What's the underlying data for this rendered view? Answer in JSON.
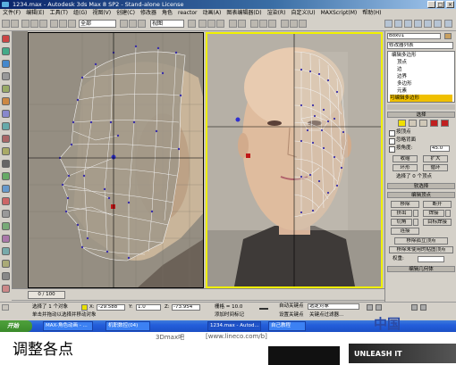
{
  "window": {
    "title": "1234.max - Autodesk 3ds Max 8 SP2 - Stand-alone License",
    "controls": [
      "_",
      "□",
      "×"
    ]
  },
  "menu": [
    "文件(F)",
    "编辑(E)",
    "工具(T)",
    "组(G)",
    "视图(V)",
    "创建(C)",
    "修改器",
    "角色",
    "reactor",
    "动画(A)",
    "图表编辑器(D)",
    "渲染(R)",
    "自定义(U)",
    "MAXScript(M)",
    "帮助(H)"
  ],
  "toolbar": {
    "filter_select": "全部",
    "view_select": "视图"
  },
  "command_panel": {
    "object_name": "Box01",
    "modifier_list": "修改器列表",
    "stack": [
      "编辑多边形",
      "顶点",
      "边",
      "边界",
      "多边形",
      "元素",
      "可编辑多边形"
    ],
    "selection_header": "选择",
    "by_vertex": "按顶点",
    "ignore_backface": "忽略背面",
    "by_angle": "按角度:",
    "angle_value": "45.0",
    "shrink": "收缩",
    "grow": "扩大",
    "ring": "环形",
    "loop": "循环",
    "selected_count": "选择了 0 个顶点",
    "soft_selection": "软选择",
    "edit_vertices": "编辑顶点",
    "remove": "移除",
    "break": "断开",
    "extrude": "挤出",
    "weld": "焊接",
    "chamfer": "切角",
    "target_weld": "目标焊接",
    "connect": "连接",
    "remove_isolated": "移除孤立顶点",
    "remove_unused_map": "移除未使用的贴图顶点",
    "weight_label": "权重:",
    "edit_geometry": "编辑几何体"
  },
  "timeline": {
    "frame": "0 / 100"
  },
  "status": {
    "selection": "选择了 1 个对象",
    "x": "-29.588",
    "y": "1.0",
    "z": "-73.954",
    "grid": "栅格 = 10.0",
    "autokey": "自动关键点",
    "set_key": "设置关键点",
    "selected_filter": "选定对象",
    "key_filters": "关键点过滤器...",
    "hint": "单击并拖动以选择并移动对象",
    "add_time_tag": "添加时间标记"
  },
  "taskbar": {
    "start": "开始",
    "tasks": [
      "MAX-角色动画 - ...",
      "机职数控(04)",
      "1234.max - Autod...",
      "自己教程"
    ]
  },
  "caption": "调整各点",
  "watermarks": {
    "left": "3Dmax吧",
    "url": "[www.lineco.com/b]",
    "logo_text": "中国",
    "logo_sub": "UNLEASH IT"
  },
  "colors": {
    "title_blue": "#0a246a",
    "active_viewport_border": "#f0f000",
    "mesh_line": "#f2f2f2",
    "vertex": "#3a2fa8",
    "taskbar": "#245edb",
    "start_green": "#3a8a2a"
  }
}
